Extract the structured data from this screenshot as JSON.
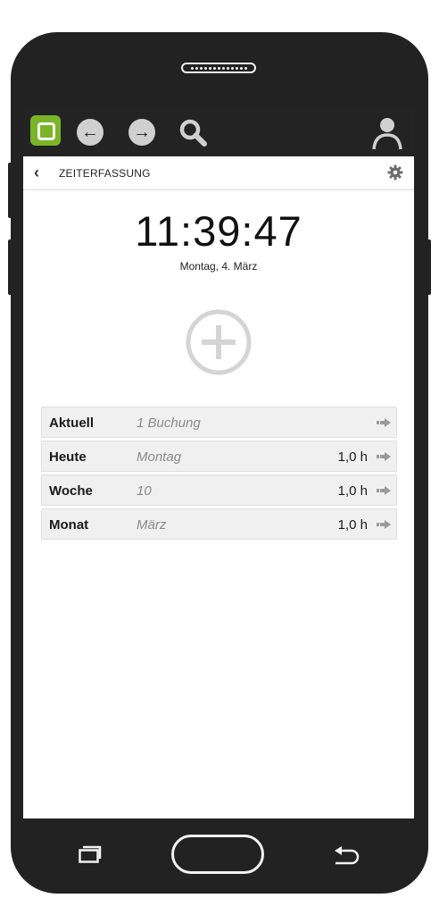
{
  "colors": {
    "accent": "#7ab527",
    "device_body": "#222222",
    "topbar_bg": "#232323",
    "icon_fill": "#d0d0d0",
    "row_bg": "#f0f0f0",
    "muted_text": "#8a8a8a",
    "add_button": "#d4d4d4"
  },
  "icons": {
    "app_logo": "app-logo-icon",
    "back": "arrow-left-icon",
    "forward": "arrow-right-icon",
    "search": "search-icon",
    "user": "user-icon",
    "settings": "gear-icon",
    "add": "plus-circle-icon",
    "row_action": "arrow-right-icon"
  },
  "header": {
    "title": "ZEITERFASSUNG"
  },
  "clock": {
    "time": "11:39:47",
    "date": "Montag, 4. März"
  },
  "summary_rows": [
    {
      "label": "Aktuell",
      "sub": "1 Buchung",
      "value": ""
    },
    {
      "label": "Heute",
      "sub": "Montag",
      "value": "1,0 h"
    },
    {
      "label": "Woche",
      "sub": "10",
      "value": "1,0 h"
    },
    {
      "label": "Monat",
      "sub": "März",
      "value": "1,0 h"
    }
  ]
}
